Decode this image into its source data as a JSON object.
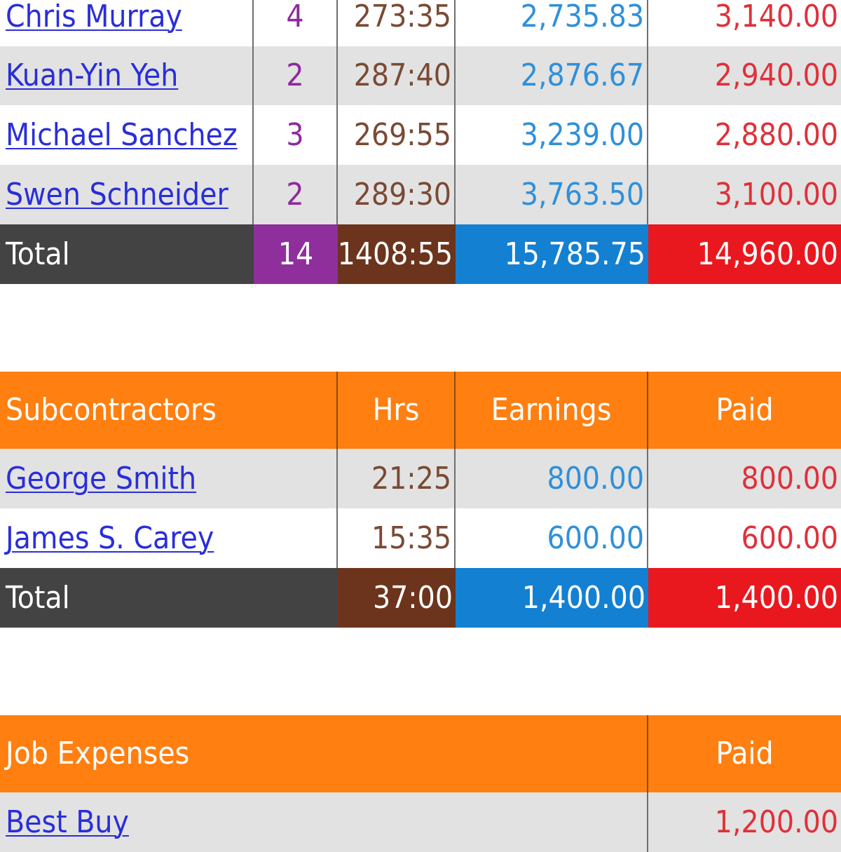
{
  "colors": {
    "header": "#ff7f11",
    "total_label": "#434343",
    "jobs": "#8e2f9c",
    "hours": "#6c341c",
    "earnings": "#1380d2",
    "paid": "#e9181f",
    "row_alt": "#e2e2e2",
    "link": "#2a2ed8"
  },
  "employees": {
    "rows": [
      {
        "name": "Chris Murray",
        "jobs": "4",
        "hrs": "273:35",
        "earnings": "2,735.83",
        "paid": "3,140.00"
      },
      {
        "name": "Kuan-Yin Yeh",
        "jobs": "2",
        "hrs": "287:40",
        "earnings": "2,876.67",
        "paid": "2,940.00"
      },
      {
        "name": "Michael Sanchez",
        "jobs": "3",
        "hrs": "269:55",
        "earnings": "3,239.00",
        "paid": "2,880.00"
      },
      {
        "name": "Swen Schneider",
        "jobs": "2",
        "hrs": "289:30",
        "earnings": "3,763.50",
        "paid": "3,100.00"
      }
    ],
    "total": {
      "label": "Total",
      "jobs": "14",
      "hrs": "1408:55",
      "earnings": "15,785.75",
      "paid": "14,960.00"
    }
  },
  "subcontractors": {
    "header": {
      "title": "Subcontractors",
      "hrs": "Hrs",
      "earnings": "Earnings",
      "paid": "Paid"
    },
    "rows": [
      {
        "name": "George Smith",
        "hrs": "21:25",
        "earnings": "800.00",
        "paid": "800.00"
      },
      {
        "name": "James S. Carey",
        "hrs": "15:35",
        "earnings": "600.00",
        "paid": "600.00"
      }
    ],
    "total": {
      "label": "Total",
      "hrs": "37:00",
      "earnings": "1,400.00",
      "paid": "1,400.00"
    }
  },
  "job_expenses": {
    "header": {
      "title": "Job Expenses",
      "paid": "Paid"
    },
    "rows": [
      {
        "name": "Best Buy",
        "paid": "1,200.00"
      }
    ]
  }
}
